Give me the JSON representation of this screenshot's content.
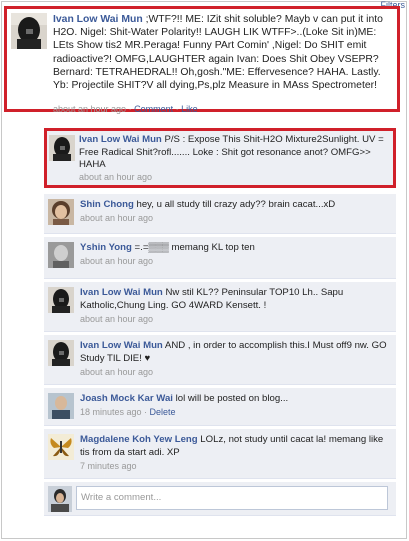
{
  "filters_label": "Filters",
  "main_post": {
    "author": "Ivan Low Wai Mun",
    "text": ";WTF?!! ME: IZit shit soluble? Mayb v can put it into H2O. Nigel: Shit-Water Polarity!! LAUGH LIK WTFF>..(Loke Sit in)ME: LEts Show tis2 MR.Peraga! Funny PArt Comin' ,Nigel: Do SHIT emit radioactive?! OMFG,LAUGHTER again Ivan: Does Shit Obey VSEPR? Bernard: TETRAHEDRAL!! Oh,gosh.\"ME: Effervesence? HAHA. Lastly. Yb: Projectile SHIT?V all dying,Ps,plz Measure in MAss Spectrometer!",
    "time": "about an hour ago",
    "sep1": " · ",
    "comment_label": "Comment",
    "sep2": " · ",
    "like_label": "Like"
  },
  "comments": [
    {
      "author": "Ivan Low Wai Mun",
      "text": " P/S : Expose This Shit-H2O Mixture2Sunlight. UV = Free Radical Shit?rofl....... Loke : Shit got resonance anot? OMFG>> HAHA",
      "time": "about an hour ago",
      "avatar": "dark-portrait"
    },
    {
      "author": "Shin Chong",
      "text": " hey, u all study till crazy ady?? brain cacat...xD",
      "time": "about an hour ago",
      "avatar": "girl-portrait"
    },
    {
      "author": "Yshin Yong",
      "text": " =.=▒▒▒ memang KL top ten",
      "time": "about an hour ago",
      "avatar": "gray-portrait"
    },
    {
      "author": "Ivan Low Wai Mun",
      "text": " Nw stil KL?? Peninsular TOP10 Lh.. Sapu Katholic,Chung Ling. GO 4WARD Kensett. !",
      "time": "about an hour ago",
      "avatar": "dark-portrait"
    },
    {
      "author": "Ivan Low Wai Mun",
      "text": " AND , in order to accomplish this.I Must off9 nw. GO Study TIL DIE! ♥",
      "time": "about an hour ago",
      "avatar": "dark-portrait"
    },
    {
      "author": "Joash Mock Kar Wai",
      "text": " lol will be posted on blog...",
      "time": "18 minutes ago",
      "delete_label": "Delete",
      "avatar": "photo-portrait"
    },
    {
      "author": "Magdalene Koh Yew Leng",
      "text": " LOLz, not study until cacat la! memang like tis from da start adi. XP",
      "time": "7 minutes ago",
      "avatar": "butterfly"
    }
  ],
  "write_comment": {
    "placeholder": "Write a comment..."
  },
  "colors": {
    "highlight": "#d0202a",
    "link": "#3b5998",
    "comment_bg": "#edeff4"
  }
}
